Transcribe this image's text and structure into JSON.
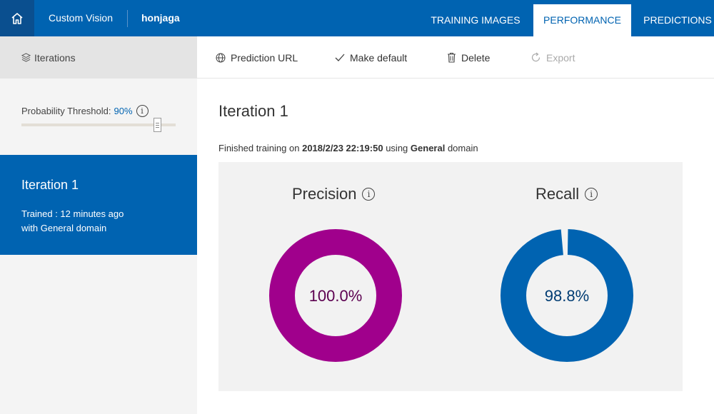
{
  "header": {
    "brand": "Custom Vision",
    "project": "honjaga",
    "tabs": [
      {
        "label": "TRAINING IMAGES"
      },
      {
        "label": "PERFORMANCE"
      },
      {
        "label": "PREDICTIONS"
      }
    ]
  },
  "sidebar": {
    "heading": "Iterations",
    "threshold_label": "Probability Threshold:",
    "threshold_value": "90%",
    "iteration": {
      "title": "Iteration 1",
      "trained": "Trained : 12 minutes ago",
      "domain": "with General domain"
    }
  },
  "toolbar": {
    "prediction_url": "Prediction URL",
    "make_default": "Make default",
    "delete": "Delete",
    "export": "Export"
  },
  "main": {
    "title": "Iteration 1",
    "trained_prefix": "Finished training on",
    "trained_date": "2018/2/23 22:19:50",
    "trained_mid": "using",
    "trained_domain": "General",
    "trained_suffix": "domain",
    "precision": {
      "label": "Precision",
      "value": "100.0%",
      "fraction": 1.0,
      "color": "#a0008c",
      "text_color": "#5c0050"
    },
    "recall": {
      "label": "Recall",
      "value": "98.8%",
      "fraction": 0.988,
      "color": "#0063b1",
      "text_color": "#003c73"
    }
  },
  "colors": {
    "accent": "#0063b1",
    "home_bg": "#0a4f8f"
  }
}
